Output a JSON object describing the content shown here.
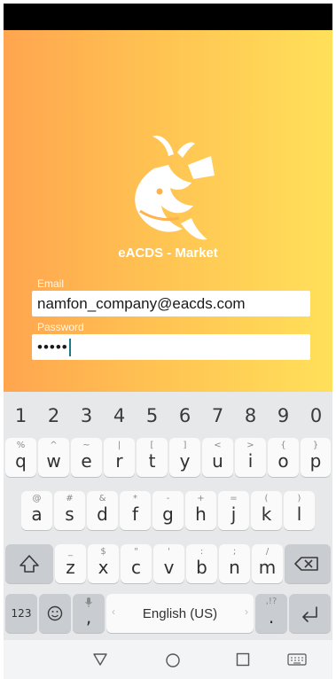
{
  "app": {
    "title": "eACDS - Market",
    "email_label": "Email",
    "email_value": "namfon_company@eacds.com",
    "password_label": "Password",
    "password_mask": "•••••"
  },
  "keyboard": {
    "numbers": [
      "1",
      "2",
      "3",
      "4",
      "5",
      "6",
      "7",
      "8",
      "9",
      "0"
    ],
    "row1": [
      [
        "q",
        "%"
      ],
      [
        "w",
        "^"
      ],
      [
        "e",
        "~"
      ],
      [
        "r",
        "|"
      ],
      [
        "t",
        "["
      ],
      [
        "y",
        "]"
      ],
      [
        "u",
        "<"
      ],
      [
        "i",
        ">"
      ],
      [
        "o",
        "{"
      ],
      [
        "p",
        "}"
      ]
    ],
    "row2": [
      [
        "a",
        "@"
      ],
      [
        "s",
        "#"
      ],
      [
        "d",
        "&"
      ],
      [
        "f",
        "*"
      ],
      [
        "g",
        "-"
      ],
      [
        "h",
        "+"
      ],
      [
        "j",
        "="
      ],
      [
        "k",
        "("
      ],
      [
        "l",
        ")"
      ]
    ],
    "row3": [
      [
        "z",
        "_"
      ],
      [
        "x",
        "$"
      ],
      [
        "c",
        "\""
      ],
      [
        "v",
        "'"
      ],
      [
        "b",
        ":"
      ],
      [
        "n",
        ";"
      ],
      [
        "m",
        "/"
      ]
    ],
    "sym_label": "123",
    "comma": ",",
    "space_label": "English (US)",
    "period": ".",
    "period_alt": ",!?"
  },
  "icons": {
    "shift": "shift-icon",
    "backspace": "backspace-icon",
    "emoji": "emoji-icon",
    "mic": "mic-icon",
    "enter": "enter-icon",
    "back": "back-icon",
    "home": "home-icon",
    "recents": "recents-icon",
    "keyboard": "keyboard-icon"
  },
  "colors": {
    "gradient_start": "#ffa54f",
    "gradient_end": "#ffe05a",
    "caret": "#1d7a86"
  }
}
